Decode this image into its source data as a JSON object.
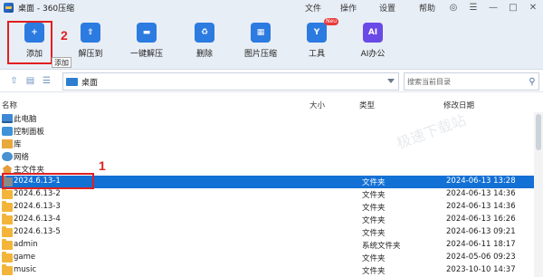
{
  "titlebar": {
    "title": "桌面 - 360压缩",
    "menu": [
      {
        "label": "文件"
      },
      {
        "label": "操作"
      },
      {
        "label": "设置"
      },
      {
        "label": "帮助"
      }
    ]
  },
  "toolbar": {
    "buttons": [
      {
        "label": "添加",
        "icon": "add-folder-icon",
        "color": "#2c7be0"
      },
      {
        "label": "解压到",
        "icon": "extract-icon",
        "color": "#2c7be0"
      },
      {
        "label": "一键解压",
        "icon": "one-click-extract-icon",
        "color": "#2c7be0"
      },
      {
        "label": "删除",
        "icon": "recycle-bin-icon",
        "color": "#2c7be0"
      },
      {
        "label": "图片压缩",
        "icon": "image-compress-icon",
        "color": "#2c7be0"
      },
      {
        "label": "工具",
        "icon": "tools-icon",
        "color": "#2c7be0",
        "badge": "Neu"
      },
      {
        "label": "AI办公",
        "icon": "ai-office-icon",
        "color": "#6a4ae6",
        "glyph": "AI"
      }
    ],
    "tooltip": "添加"
  },
  "annotations": {
    "first": "1",
    "second": "2"
  },
  "address": {
    "path": "桌面",
    "search_placeholder": "搜索当前目录"
  },
  "columns": {
    "name": "名称",
    "size": "大小",
    "type": "类型",
    "modified": "修改日期"
  },
  "watermark": "极速下载站",
  "files": [
    {
      "name": "此电脑",
      "type": "",
      "date": "",
      "icon": "pc"
    },
    {
      "name": "控制面板",
      "type": "",
      "date": "",
      "icon": "control-panel"
    },
    {
      "name": "库",
      "type": "",
      "date": "",
      "icon": "library"
    },
    {
      "name": "网络",
      "type": "",
      "date": "",
      "icon": "network"
    },
    {
      "name": "主文件夹",
      "type": "",
      "date": "",
      "icon": "home"
    },
    {
      "name": "2024.6.13-1",
      "type": "文件夹",
      "date": "2024-06-13 13:28",
      "icon": "folder-gray",
      "selected": true
    },
    {
      "name": "2024.6.13-2",
      "type": "文件夹",
      "date": "2024-06-13 14:36",
      "icon": "folder"
    },
    {
      "name": "2024.6.13-3",
      "type": "文件夹",
      "date": "2024-06-13 14:36",
      "icon": "folder"
    },
    {
      "name": "2024.6.13-4",
      "type": "文件夹",
      "date": "2024-06-13 16:26",
      "icon": "folder"
    },
    {
      "name": "2024.6.13-5",
      "type": "文件夹",
      "date": "2024-06-13 09:21",
      "icon": "folder"
    },
    {
      "name": "admin",
      "type": "系统文件夹",
      "date": "2024-06-11 18:17",
      "icon": "folder"
    },
    {
      "name": "game",
      "type": "文件夹",
      "date": "2024-05-06 09:23",
      "icon": "folder"
    },
    {
      "name": "music",
      "type": "文件夹",
      "date": "2023-10-10 14:37",
      "icon": "folder"
    }
  ]
}
